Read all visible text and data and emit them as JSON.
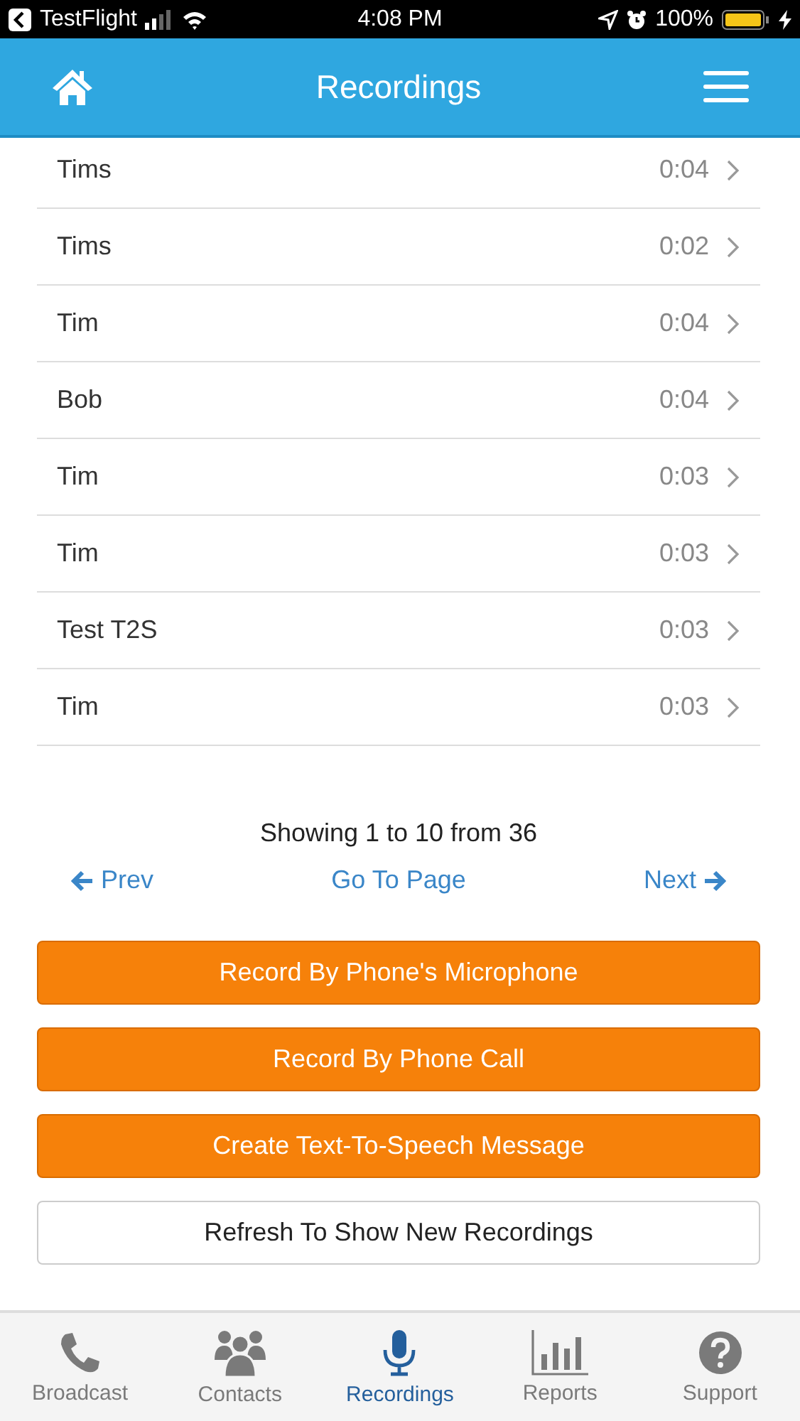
{
  "status_bar": {
    "back_app": "TestFlight",
    "time": "4:08 PM",
    "battery": "100%"
  },
  "header": {
    "title": "Recordings"
  },
  "recordings": [
    {
      "name": "Tims",
      "duration": "0:04"
    },
    {
      "name": "Tims",
      "duration": "0:02"
    },
    {
      "name": "Tim",
      "duration": "0:04"
    },
    {
      "name": "Bob",
      "duration": "0:04"
    },
    {
      "name": "Tim",
      "duration": "0:03"
    },
    {
      "name": "Tim",
      "duration": "0:03"
    },
    {
      "name": "Test T2S",
      "duration": "0:03"
    },
    {
      "name": "Tim",
      "duration": "0:03"
    }
  ],
  "pagination": {
    "summary": "Showing 1 to 10 from 36",
    "prev": "Prev",
    "goto": "Go To Page",
    "next": "Next"
  },
  "actions": [
    {
      "label": "Record By Phone's Microphone",
      "kind": "primary"
    },
    {
      "label": "Record By Phone Call",
      "kind": "primary"
    },
    {
      "label": "Create Text-To-Speech Message",
      "kind": "primary"
    },
    {
      "label": "Refresh To Show New Recordings",
      "kind": "secondary"
    }
  ],
  "tabs": [
    {
      "label": "Broadcast",
      "kind": "phone",
      "selected": false
    },
    {
      "label": "Contacts",
      "kind": "people",
      "selected": false
    },
    {
      "label": "Recordings",
      "kind": "mic",
      "selected": true
    },
    {
      "label": "Reports",
      "kind": "chart",
      "selected": false
    },
    {
      "label": "Support",
      "kind": "help",
      "selected": false
    }
  ]
}
